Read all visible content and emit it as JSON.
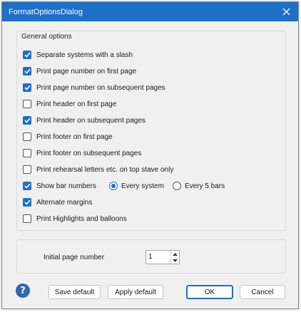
{
  "window": {
    "title": "FormatOptionsDialog"
  },
  "general_options": {
    "title": "General options",
    "options": [
      {
        "label": "Separate systems with a slash",
        "checked": true
      },
      {
        "label": "Print page number on first page",
        "checked": true
      },
      {
        "label": "Print page number on subsequent pages",
        "checked": true
      },
      {
        "label": "Print header on first page",
        "checked": false
      },
      {
        "label": "Print header on subsequent pages",
        "checked": true
      },
      {
        "label": "Print footer on first page",
        "checked": false
      },
      {
        "label": "Print footer on subsequent pages",
        "checked": false
      },
      {
        "label": "Print rehearsal letters etc. on top stave only",
        "checked": false
      },
      {
        "label": "Show bar numbers",
        "checked": true
      },
      {
        "label": "Alternate margins",
        "checked": true
      },
      {
        "label": "Print Highlights and balloons",
        "checked": false
      }
    ],
    "bar_number_mode": {
      "selected": "Every system",
      "choices": [
        "Every system",
        "Every 5 bars"
      ]
    }
  },
  "initial_page": {
    "label": "Initial page number",
    "value": "1"
  },
  "buttons": {
    "save_default": "Save default",
    "apply_default": "Apply default",
    "ok": "OK",
    "cancel": "Cancel",
    "help": "?"
  },
  "colors": {
    "accent": "#1e6fc8",
    "titlebar": "#1e6fc8",
    "dialog_bg": "#f0f0f0"
  }
}
